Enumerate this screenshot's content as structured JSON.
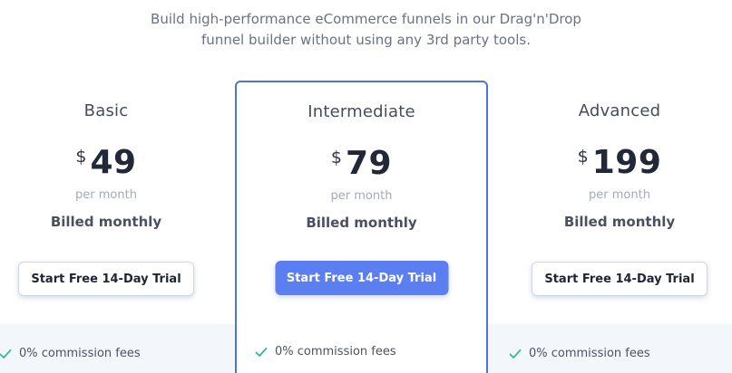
{
  "header": {
    "subtitle_line1": "Build high-performance eCommerce funnels in our Drag'n'Drop",
    "subtitle_line2": "funnel builder without using any 3rd party tools."
  },
  "plans": [
    {
      "name": "Basic",
      "currency": "$",
      "price": "49",
      "period": "per month",
      "billing": "Billed monthly",
      "cta": "Start Free 14-Day Trial",
      "feature": "0% commission fees"
    },
    {
      "name": "Intermediate",
      "currency": "$",
      "price": "79",
      "period": "per month",
      "billing": "Billed monthly",
      "cta": "Start Free 14-Day Trial",
      "feature": "0% commission fees"
    },
    {
      "name": "Advanced",
      "currency": "$",
      "price": "199",
      "period": "per month",
      "billing": "Billed monthly",
      "cta": "Start Free 14-Day Trial",
      "feature": "0% commission fees"
    }
  ],
  "featured_plan": "Intermediate",
  "icons": {
    "check": "check-icon"
  },
  "colors": {
    "accent": "#5b7ef0",
    "featured_border": "#4d73e0",
    "check": "#2fb89a"
  }
}
